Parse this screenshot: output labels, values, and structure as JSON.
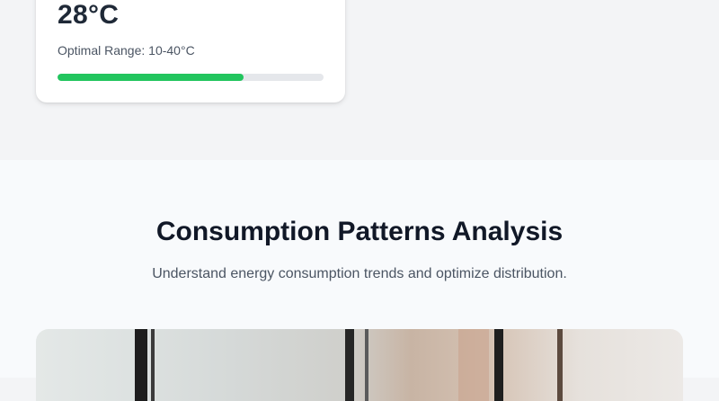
{
  "metric_card": {
    "value": "28°C",
    "range_label": "Optimal Range: 10-40°C",
    "progress_percent": 70,
    "progress_color": "#22c55e"
  },
  "analysis": {
    "title": "Consumption Patterns Analysis",
    "subtitle": "Understand energy consumption trends and optimize distribution."
  }
}
